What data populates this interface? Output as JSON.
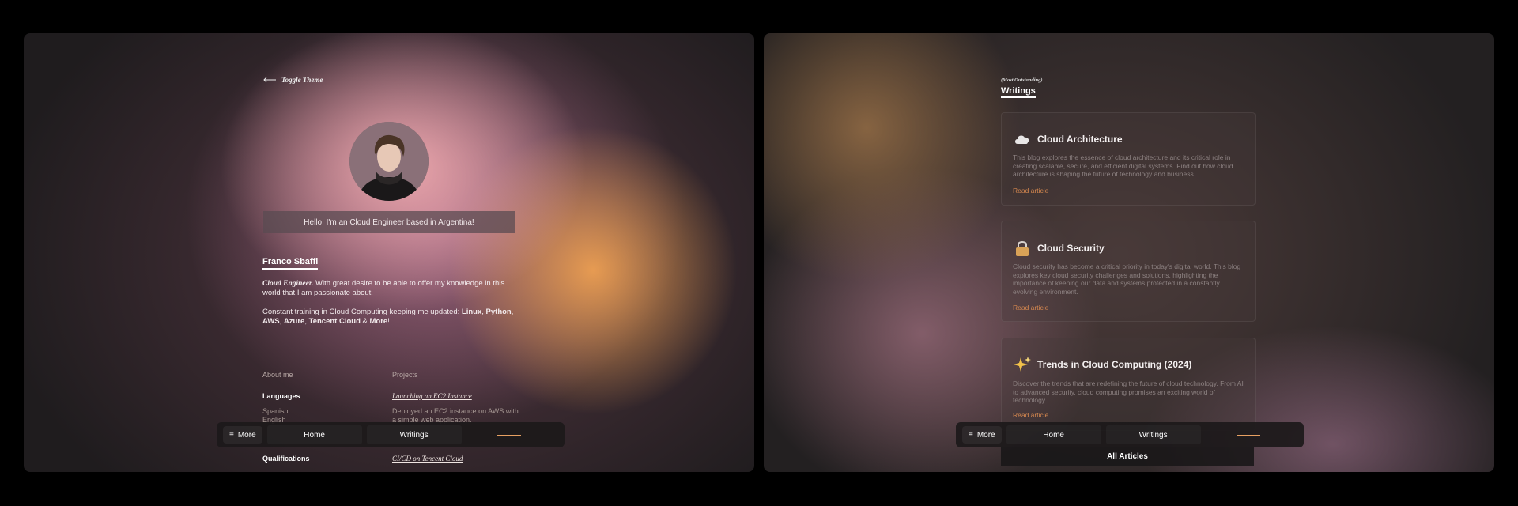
{
  "left": {
    "toggle_theme": "Toggle Theme",
    "greeting": "Hello, I'm an Cloud Engineer based in Argentina!",
    "name": "Franco Sbaffi",
    "bio": {
      "role": "Cloud Engineer.",
      "text": " With great desire to be able to offer my knowledge in this world that I am passionate about.",
      "training_text": "Constant training in Cloud Computing keeping me updated: ",
      "skills": [
        "Linux",
        "Python",
        "AWS",
        "Azure",
        "Tencent Cloud",
        "More"
      ],
      "and_word": "&"
    },
    "about_me": "About me",
    "projects": "Projects",
    "languages_heading": "Languages",
    "languages": [
      "Spanish",
      "English"
    ],
    "qualifications_heading": "Qualifications",
    "project_1": {
      "title": "Launching an EC2 Instance",
      "desc": "Deployed an EC2 instance on AWS with a simple web application."
    },
    "project_2": {
      "title": "CI/CD on Tencent Cloud"
    }
  },
  "nav": {
    "more": "More",
    "home": "Home",
    "writings": "Writings"
  },
  "right": {
    "eyebrow": "(Most Outstanding)",
    "title": "Writings",
    "articles": [
      {
        "icon": "cloud-icon",
        "title": "Cloud Architecture",
        "desc": "This blog explores the essence of cloud architecture and its critical role in creating scalable, secure, and efficient digital systems. Find out how cloud architecture is shaping the future of technology and business.",
        "link": "Read article"
      },
      {
        "icon": "lock-icon",
        "title": "Cloud Security",
        "desc": "Cloud security has become a critical priority in today's digital world. This blog explores key cloud security challenges and solutions, highlighting the importance of keeping our data and systems protected in a constantly evolving environment.",
        "link": "Read article"
      },
      {
        "icon": "sparkles-icon",
        "title": "Trends in Cloud Computing (2024)",
        "desc": "Discover the trends that are redefining the future of cloud technology. From AI to advanced security, cloud computing promises an exciting world of technology.",
        "link": "Read article"
      }
    ],
    "all_articles": "All Articles"
  },
  "colors": {
    "accent": "#d4874f",
    "panel": "#1e1b1d"
  }
}
